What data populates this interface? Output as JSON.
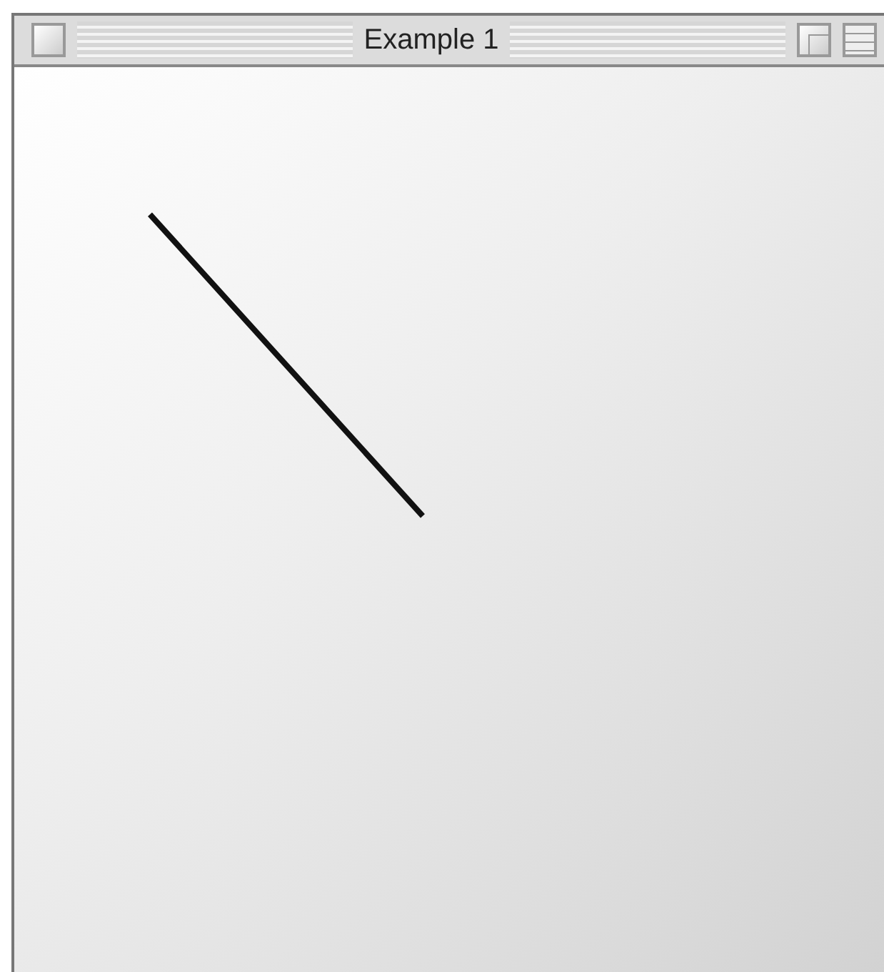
{
  "window": {
    "title": "Example 1"
  }
}
